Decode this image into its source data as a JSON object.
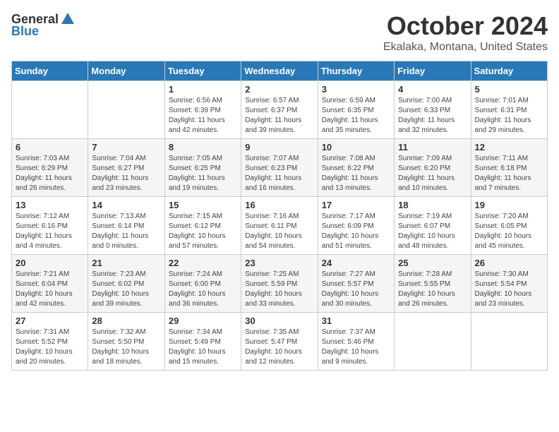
{
  "header": {
    "logo_general": "General",
    "logo_blue": "Blue",
    "month": "October 2024",
    "location": "Ekalaka, Montana, United States"
  },
  "weekdays": [
    "Sunday",
    "Monday",
    "Tuesday",
    "Wednesday",
    "Thursday",
    "Friday",
    "Saturday"
  ],
  "weeks": [
    [
      {
        "day": "",
        "info": ""
      },
      {
        "day": "",
        "info": ""
      },
      {
        "day": "1",
        "info": "Sunrise: 6:56 AM\nSunset: 6:39 PM\nDaylight: 11 hours and 42 minutes."
      },
      {
        "day": "2",
        "info": "Sunrise: 6:57 AM\nSunset: 6:37 PM\nDaylight: 11 hours and 39 minutes."
      },
      {
        "day": "3",
        "info": "Sunrise: 6:59 AM\nSunset: 6:35 PM\nDaylight: 11 hours and 35 minutes."
      },
      {
        "day": "4",
        "info": "Sunrise: 7:00 AM\nSunset: 6:33 PM\nDaylight: 11 hours and 32 minutes."
      },
      {
        "day": "5",
        "info": "Sunrise: 7:01 AM\nSunset: 6:31 PM\nDaylight: 11 hours and 29 minutes."
      }
    ],
    [
      {
        "day": "6",
        "info": "Sunrise: 7:03 AM\nSunset: 6:29 PM\nDaylight: 11 hours and 26 minutes."
      },
      {
        "day": "7",
        "info": "Sunrise: 7:04 AM\nSunset: 6:27 PM\nDaylight: 11 hours and 23 minutes."
      },
      {
        "day": "8",
        "info": "Sunrise: 7:05 AM\nSunset: 6:25 PM\nDaylight: 11 hours and 19 minutes."
      },
      {
        "day": "9",
        "info": "Sunrise: 7:07 AM\nSunset: 6:23 PM\nDaylight: 11 hours and 16 minutes."
      },
      {
        "day": "10",
        "info": "Sunrise: 7:08 AM\nSunset: 6:22 PM\nDaylight: 11 hours and 13 minutes."
      },
      {
        "day": "11",
        "info": "Sunrise: 7:09 AM\nSunset: 6:20 PM\nDaylight: 11 hours and 10 minutes."
      },
      {
        "day": "12",
        "info": "Sunrise: 7:11 AM\nSunset: 6:18 PM\nDaylight: 11 hours and 7 minutes."
      }
    ],
    [
      {
        "day": "13",
        "info": "Sunrise: 7:12 AM\nSunset: 6:16 PM\nDaylight: 11 hours and 4 minutes."
      },
      {
        "day": "14",
        "info": "Sunrise: 7:13 AM\nSunset: 6:14 PM\nDaylight: 11 hours and 0 minutes."
      },
      {
        "day": "15",
        "info": "Sunrise: 7:15 AM\nSunset: 6:12 PM\nDaylight: 10 hours and 57 minutes."
      },
      {
        "day": "16",
        "info": "Sunrise: 7:16 AM\nSunset: 6:11 PM\nDaylight: 10 hours and 54 minutes."
      },
      {
        "day": "17",
        "info": "Sunrise: 7:17 AM\nSunset: 6:09 PM\nDaylight: 10 hours and 51 minutes."
      },
      {
        "day": "18",
        "info": "Sunrise: 7:19 AM\nSunset: 6:07 PM\nDaylight: 10 hours and 48 minutes."
      },
      {
        "day": "19",
        "info": "Sunrise: 7:20 AM\nSunset: 6:05 PM\nDaylight: 10 hours and 45 minutes."
      }
    ],
    [
      {
        "day": "20",
        "info": "Sunrise: 7:21 AM\nSunset: 6:04 PM\nDaylight: 10 hours and 42 minutes."
      },
      {
        "day": "21",
        "info": "Sunrise: 7:23 AM\nSunset: 6:02 PM\nDaylight: 10 hours and 39 minutes."
      },
      {
        "day": "22",
        "info": "Sunrise: 7:24 AM\nSunset: 6:00 PM\nDaylight: 10 hours and 36 minutes."
      },
      {
        "day": "23",
        "info": "Sunrise: 7:25 AM\nSunset: 5:59 PM\nDaylight: 10 hours and 33 minutes."
      },
      {
        "day": "24",
        "info": "Sunrise: 7:27 AM\nSunset: 5:57 PM\nDaylight: 10 hours and 30 minutes."
      },
      {
        "day": "25",
        "info": "Sunrise: 7:28 AM\nSunset: 5:55 PM\nDaylight: 10 hours and 26 minutes."
      },
      {
        "day": "26",
        "info": "Sunrise: 7:30 AM\nSunset: 5:54 PM\nDaylight: 10 hours and 23 minutes."
      }
    ],
    [
      {
        "day": "27",
        "info": "Sunrise: 7:31 AM\nSunset: 5:52 PM\nDaylight: 10 hours and 20 minutes."
      },
      {
        "day": "28",
        "info": "Sunrise: 7:32 AM\nSunset: 5:50 PM\nDaylight: 10 hours and 18 minutes."
      },
      {
        "day": "29",
        "info": "Sunrise: 7:34 AM\nSunset: 5:49 PM\nDaylight: 10 hours and 15 minutes."
      },
      {
        "day": "30",
        "info": "Sunrise: 7:35 AM\nSunset: 5:47 PM\nDaylight: 10 hours and 12 minutes."
      },
      {
        "day": "31",
        "info": "Sunrise: 7:37 AM\nSunset: 5:46 PM\nDaylight: 10 hours and 9 minutes."
      },
      {
        "day": "",
        "info": ""
      },
      {
        "day": "",
        "info": ""
      }
    ]
  ]
}
